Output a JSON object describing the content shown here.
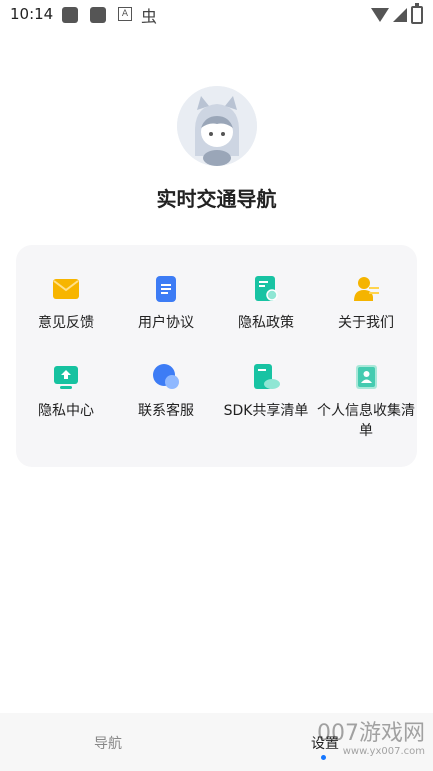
{
  "status_bar": {
    "time": "10:14",
    "letter_icon": "A",
    "bug_glyph": "虫"
  },
  "header": {
    "app_title": "实时交通导航"
  },
  "grid": {
    "items": [
      {
        "label": "意见反馈",
        "icon": "mail-icon",
        "color": "#f7b500"
      },
      {
        "label": "用户协议",
        "icon": "document-icon",
        "color": "#3d7cf5"
      },
      {
        "label": "隐私政策",
        "icon": "privacy-doc-icon",
        "color": "#18c3a3"
      },
      {
        "label": "关于我们",
        "icon": "person-card-icon",
        "color": "#f5b400"
      },
      {
        "label": "隐私中心",
        "icon": "monitor-upload-icon",
        "color": "#16c2a0"
      },
      {
        "label": "联系客服",
        "icon": "chat-bubble-icon",
        "color": "#3d7cf5"
      },
      {
        "label": "SDK共享清单",
        "icon": "sdk-share-icon",
        "color": "#18c3a3"
      },
      {
        "label": "个人信息收集清单",
        "icon": "contact-book-icon",
        "color": "#45cbb0"
      }
    ]
  },
  "bottom_nav": {
    "tabs": [
      {
        "label": "导航",
        "active": false
      },
      {
        "label": "设置",
        "active": true
      }
    ],
    "active_color": "#1677ff"
  },
  "watermark": {
    "text": "007游戏网",
    "url": "www.yx007.com"
  }
}
